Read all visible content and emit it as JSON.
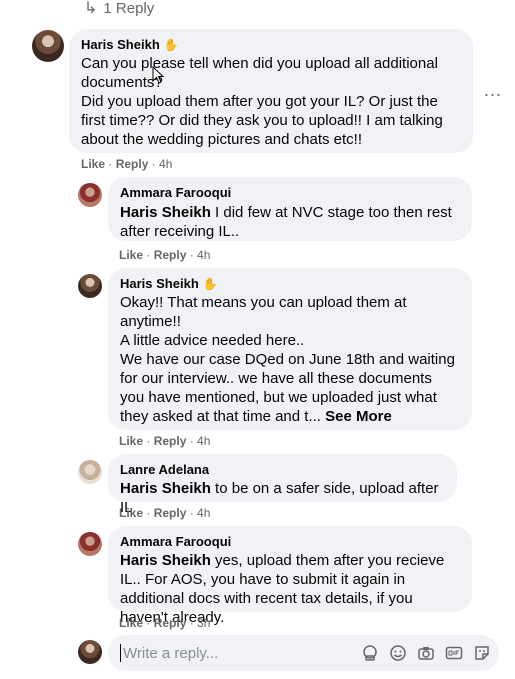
{
  "top_reply_link": {
    "arrow": "↳",
    "label": "1 Reply"
  },
  "comments": [
    {
      "author": "Haris Sheikh",
      "author_badge": "wave-icon",
      "lines": [
        "Can you please tell when did you upload all additional documents?",
        "Did you upload them after you got your IL? Or just the first time?? Or did they ask you to upload!! I am talking about the wedding pictures and chats etc!!"
      ],
      "actions": {
        "like": "Like",
        "reply": "Reply",
        "time": "4h"
      }
    },
    {
      "author": "Ammara Farooqui",
      "mention": "Haris Sheikh",
      "text": "I did few at NVC stage too then rest after receiving IL..",
      "actions": {
        "like": "Like",
        "reply": "Reply",
        "time": "4h"
      }
    },
    {
      "author": "Haris Sheikh",
      "author_badge": "wave-icon",
      "lines": [
        "Okay!! That means you can upload them at anytime!!",
        "A little advice needed here..",
        "We have our case DQed on June 18th and waiting for our interview.. we have all these documents you have mentioned, but we uploaded just what they asked at that time and t..."
      ],
      "see_more": "See More",
      "actions": {
        "like": "Like",
        "reply": "Reply",
        "time": "4h"
      }
    },
    {
      "author": "Lanre Adelana",
      "mention": "Haris Sheikh",
      "text": "to be on a safer side, upload after IL",
      "actions": {
        "like": "Like",
        "reply": "Reply",
        "time": "4h"
      }
    },
    {
      "author": "Ammara Farooqui",
      "mention": "Haris Sheikh",
      "text": "yes, upload them after you recieve IL.. For AOS, you have to submit it again in additional docs with recent tax details, if you haven't already.",
      "actions": {
        "like": "Like",
        "reply": "Reply",
        "time": "3h"
      }
    }
  ],
  "reply_box": {
    "placeholder": "Write a reply...",
    "icons": [
      "avatar-sticker-icon",
      "emoji-icon",
      "camera-icon",
      "gif-icon",
      "sticker-icon"
    ]
  },
  "more_options": "..."
}
